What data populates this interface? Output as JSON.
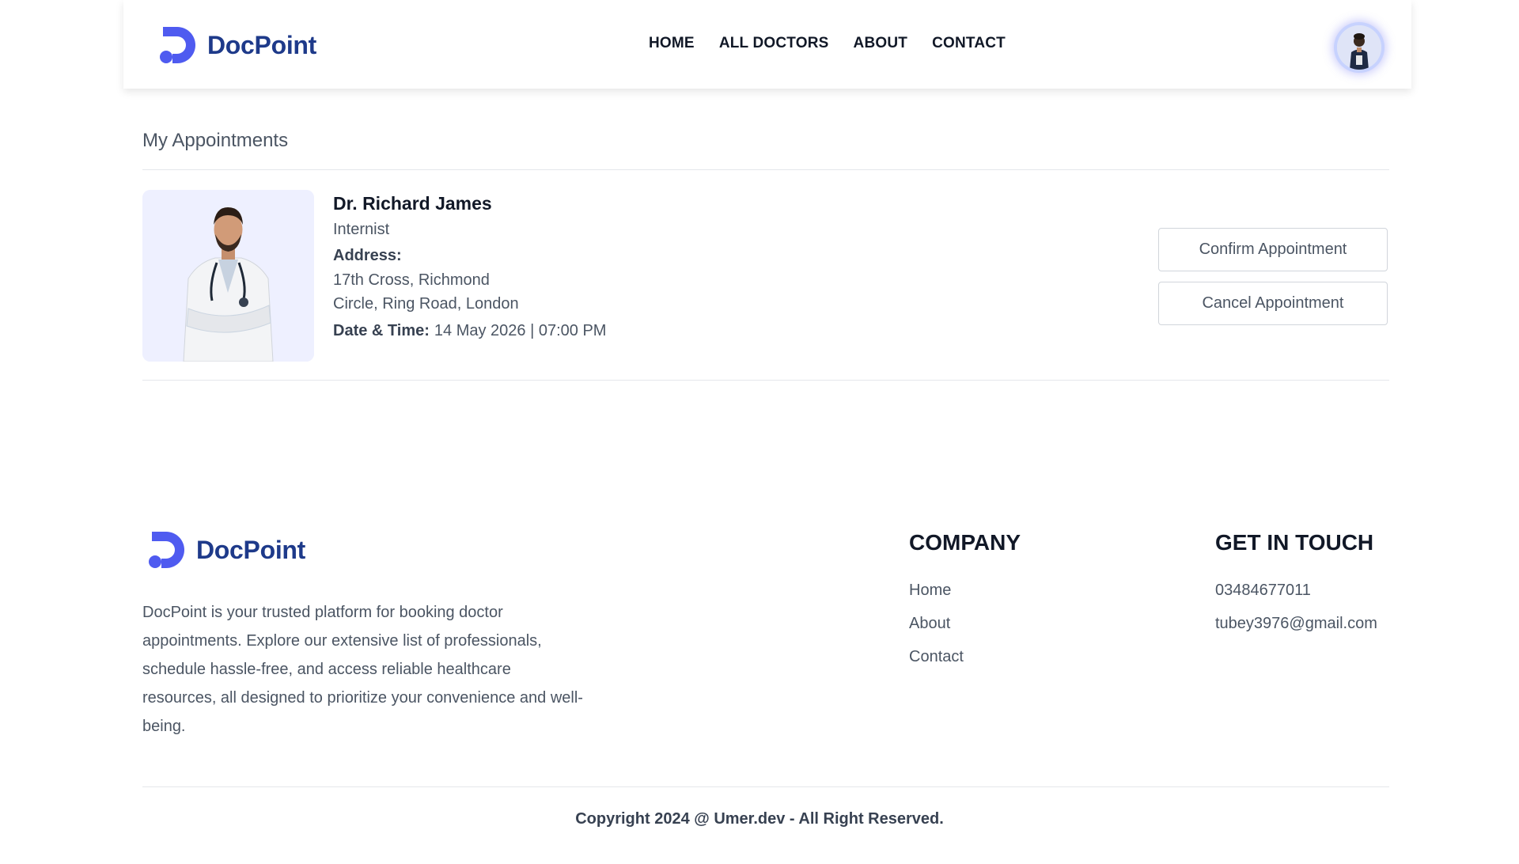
{
  "brand": {
    "name": "DocPoint",
    "color": "#1e3a8a",
    "accent": "#4f5bf0"
  },
  "nav": {
    "items": [
      "HOME",
      "ALL DOCTORS",
      "ABOUT",
      "CONTACT"
    ]
  },
  "user": {
    "avatar_icon": "user-avatar"
  },
  "page_title": "My Appointments",
  "appointment": {
    "name": "Dr. Richard James",
    "speciality": "Internist",
    "address_label": "Address:",
    "address_line1": "17th Cross, Richmond",
    "address_line2": "Circle, Ring Road, London",
    "datetime_label": "Date & Time:",
    "datetime": "14 May 2026 | 07:00 PM",
    "confirm_label": "Confirm Appointment",
    "cancel_label": "Cancel Appointment"
  },
  "footer": {
    "brand": "DocPoint",
    "description": "DocPoint is your trusted platform for booking doctor appointments. Explore our extensive list of professionals, schedule hassle-free, and access reliable healthcare resources, all designed to prioritize your convenience and well-being.",
    "company_title": "COMPANY",
    "company_links": [
      "Home",
      "About",
      "Contact"
    ],
    "contact_title": "GET IN TOUCH",
    "phone": "03484677011",
    "email": "tubey3976@gmail.com",
    "copyright": "Copyright 2024 @ Umer.dev - All Right Reserved."
  }
}
